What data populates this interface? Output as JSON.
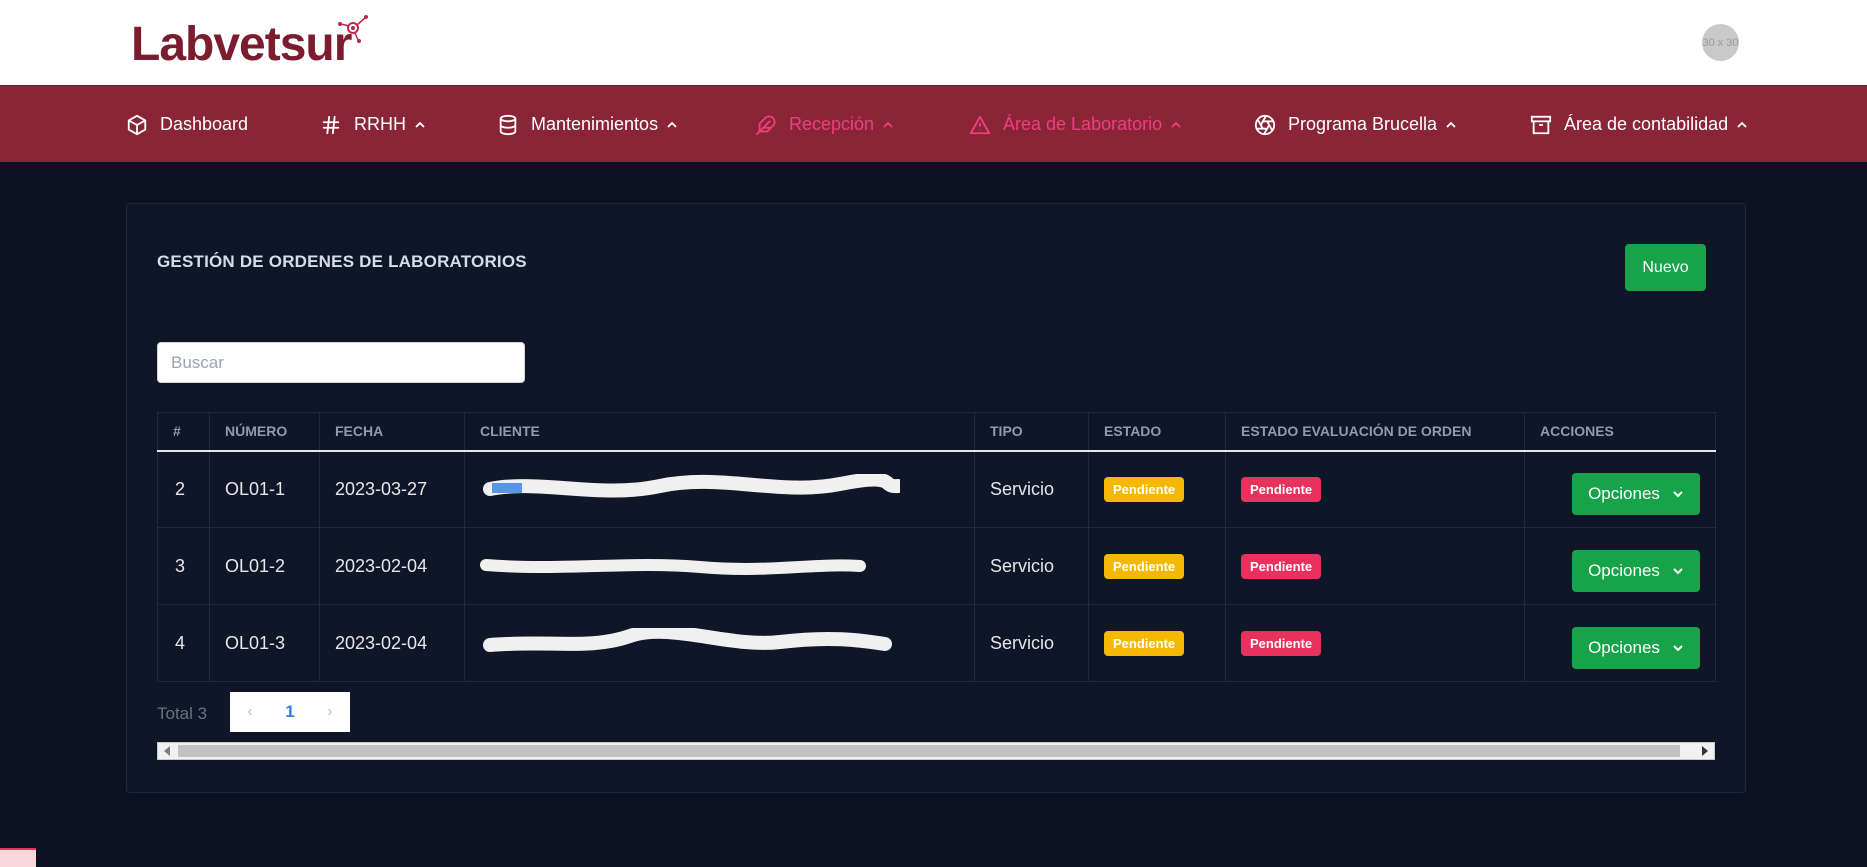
{
  "header": {
    "logo_text": "Labvetsur",
    "avatar_text": "30 x 30"
  },
  "nav": {
    "items": [
      {
        "label": "Dashboard",
        "icon": "cube-icon"
      },
      {
        "label": "RRHH",
        "icon": "hash-icon"
      },
      {
        "label": "Mantenimientos",
        "icon": "database-icon"
      },
      {
        "label": "Recepción",
        "icon": "feather-icon"
      },
      {
        "label": "Área de Laboratorio",
        "icon": "alert-triangle-icon"
      },
      {
        "label": "Programa Brucella",
        "icon": "aperture-icon"
      },
      {
        "label": "Área de contabilidad",
        "icon": "archive-icon"
      }
    ],
    "active_color": "#ec3f80"
  },
  "page": {
    "title": "GESTIÓN DE ORDENES DE LABORATORIOS",
    "new_button": "Nuevo",
    "search_placeholder": "Buscar"
  },
  "table": {
    "headers": [
      "#",
      "NÚMERO",
      "FECHA",
      "CLIENTE",
      "TIPO",
      "ESTADO",
      "ESTADO EVALUACIÓN DE ORDEN",
      "ACCIONES"
    ],
    "rows": [
      {
        "id": "2",
        "numero": "OL01-1",
        "fecha": "2023-03-27",
        "cliente": "",
        "tipo": "Servicio",
        "estado": "Pendiente",
        "evaluacion": "Pendiente",
        "accion": "Opciones"
      },
      {
        "id": "3",
        "numero": "OL01-2",
        "fecha": "2023-02-04",
        "cliente": "",
        "tipo": "Servicio",
        "estado": "Pendiente",
        "evaluacion": "Pendiente",
        "accion": "Opciones"
      },
      {
        "id": "4",
        "numero": "OL01-3",
        "fecha": "2023-02-04",
        "cliente": "",
        "tipo": "Servicio",
        "estado": "Pendiente",
        "evaluacion": "Pendiente",
        "accion": "Opciones"
      }
    ]
  },
  "pagination": {
    "total_label": "Total 3",
    "current_page": "1",
    "prev": "‹",
    "next": "›"
  },
  "colors": {
    "brand": "#7b1d2e",
    "nav_bg": "#8a2538",
    "success": "#16a34a",
    "warning": "#f5b800",
    "danger": "#e8315c"
  }
}
